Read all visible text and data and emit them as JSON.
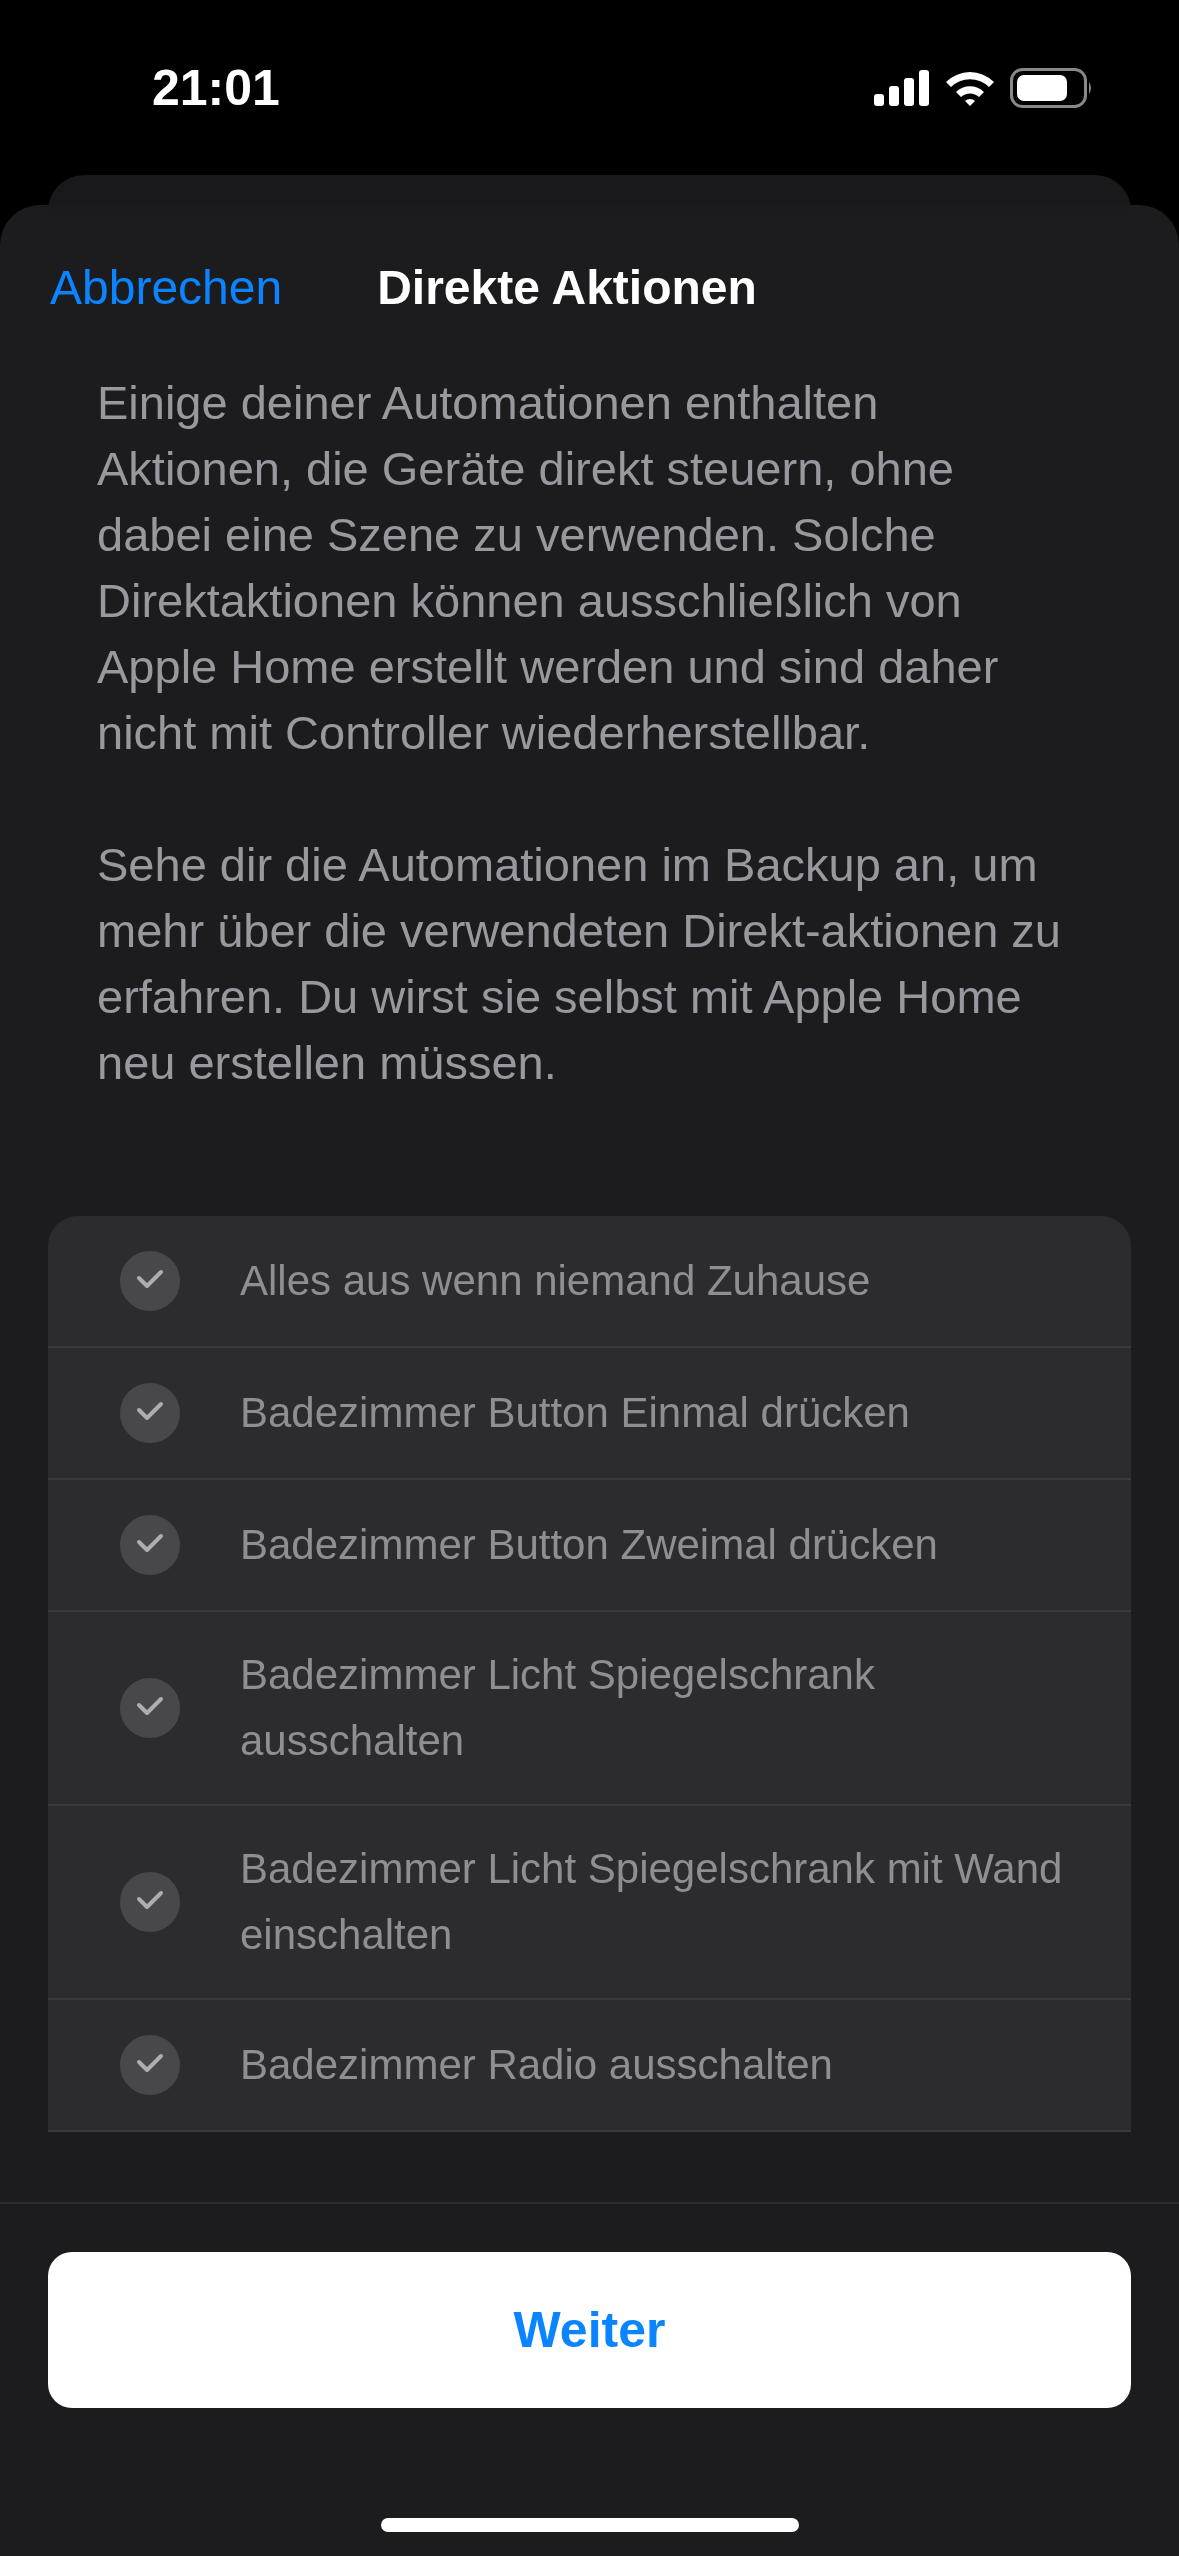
{
  "status_bar": {
    "time": "21:01"
  },
  "nav": {
    "cancel": "Abbrechen",
    "title": "Direkte Aktionen"
  },
  "paragraphs": [
    "Einige deiner Automationen enthalten Aktionen, die Geräte direkt steuern, ohne dabei eine Szene zu verwenden. Solche Direktaktionen können ausschließlich von Apple Home erstellt werden und sind daher nicht mit Controller wiederherstellbar.",
    "Sehe dir die Automationen im Backup an, um mehr über die verwendeten Direkt-aktionen zu erfahren. Du wirst sie selbst mit Apple Home neu erstellen müssen."
  ],
  "automations": [
    {
      "name": "Alles aus wenn niemand Zuhause",
      "checked": true
    },
    {
      "name": "Badezimmer Button Einmal drücken",
      "checked": true
    },
    {
      "name": "Badezimmer Button Zweimal drücken",
      "checked": true
    },
    {
      "name": "Badezimmer Licht Spiegelschrank ausschalten",
      "checked": true
    },
    {
      "name": "Badezimmer Licht Spiegelschrank mit Wand einschalten",
      "checked": true
    },
    {
      "name": "Badezimmer Radio ausschalten",
      "checked": true
    }
  ],
  "continue_button": "Weiter"
}
